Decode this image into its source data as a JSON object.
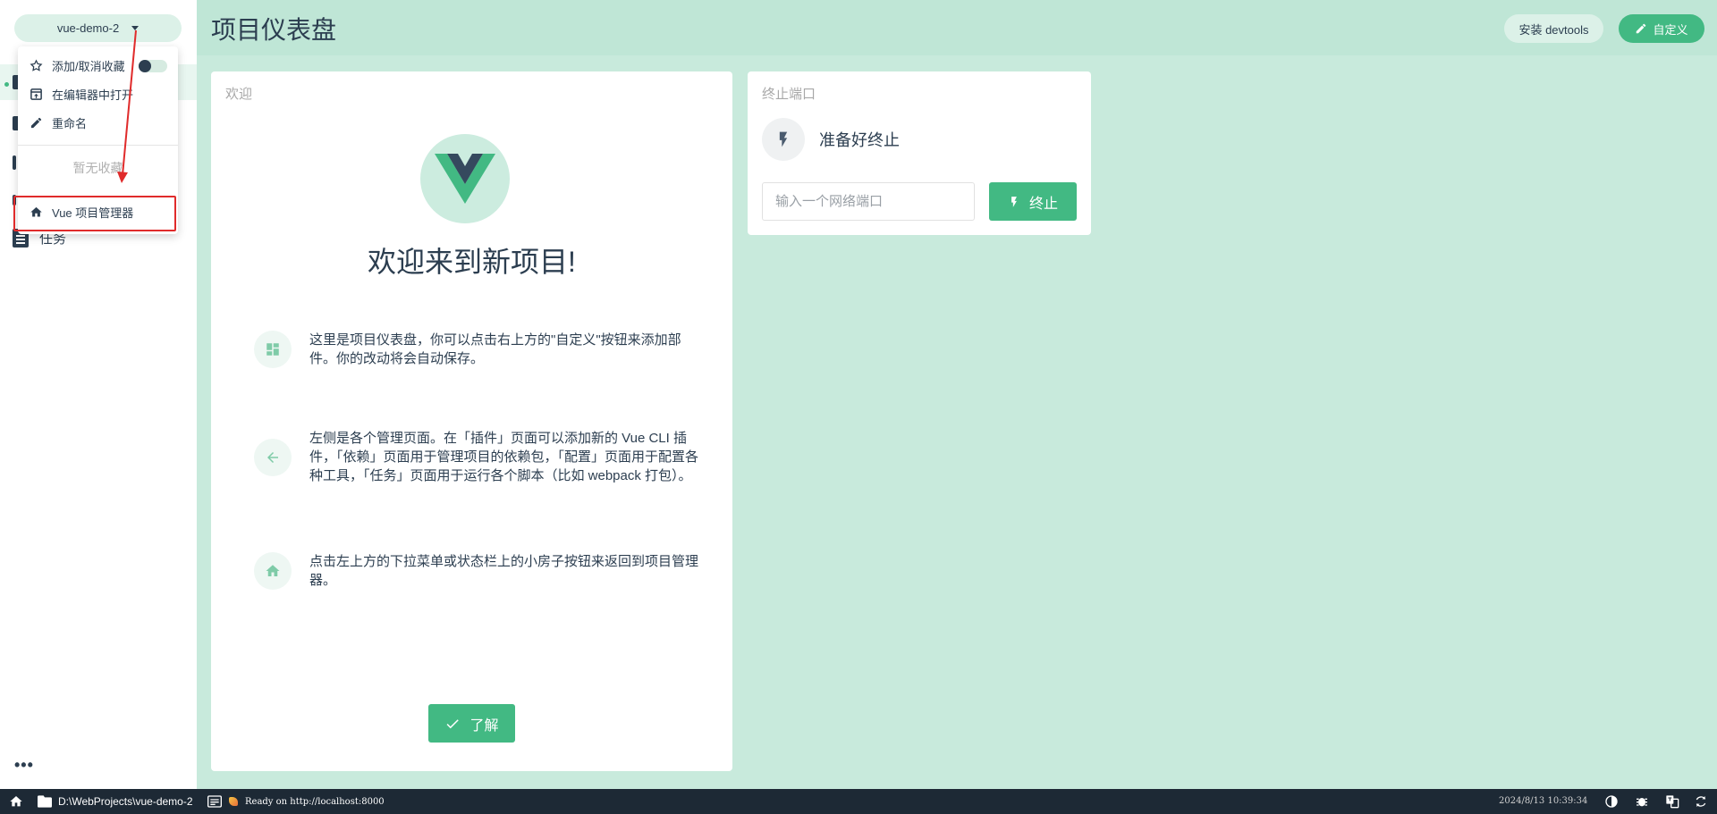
{
  "sidebar": {
    "project_name": "vue-demo-2",
    "nav_task_label": "任务",
    "more_label": "•••"
  },
  "dropdown": {
    "items": [
      {
        "label": "添加/取消收藏",
        "icon": "star-icon"
      },
      {
        "label": "在编辑器中打开",
        "icon": "open-in-editor-icon"
      },
      {
        "label": "重命名",
        "icon": "pencil-icon"
      }
    ],
    "empty_favorites": "暂无收藏",
    "project_manager": "Vue 项目管理器"
  },
  "header": {
    "title": "项目仪表盘",
    "devtools_label": "安装 devtools",
    "customize_label": "自定义"
  },
  "welcome": {
    "card_title": "欢迎",
    "heading": "欢迎来到新项目!",
    "tips": [
      {
        "icon": "dashboard-icon",
        "text": "这里是项目仪表盘，你可以点击右上方的\"自定义\"按钮来添加部件。你的改动将会自动保存。"
      },
      {
        "icon": "arrow-left-icon",
        "text": "左侧是各个管理页面。在「插件」页面可以添加新的 Vue CLI 插件，「依赖」页面用于管理项目的依赖包，「配置」页面用于配置各种工具，「任务」页面用于运行各个脚本（比如 webpack 打包）。"
      },
      {
        "icon": "home-icon",
        "text": "点击左上方的下拉菜单或状态栏上的小房子按钮来返回到项目管理器。"
      }
    ],
    "ok_label": "了解"
  },
  "kill_port": {
    "card_title": "终止端口",
    "status": "准备好终止",
    "input_placeholder": "输入一个网络端口",
    "button_label": "终止"
  },
  "statusbar": {
    "path": "D:\\WebProjects\\vue-demo-2",
    "log": "Ready on http://localhost:8000",
    "time": "2024/8/13 10:39:34"
  },
  "colors": {
    "accent": "#42b983",
    "background": "#c8eadc",
    "text": "#2c3e50",
    "statusbar": "#1d2935",
    "highlight": "#e02b2b"
  }
}
